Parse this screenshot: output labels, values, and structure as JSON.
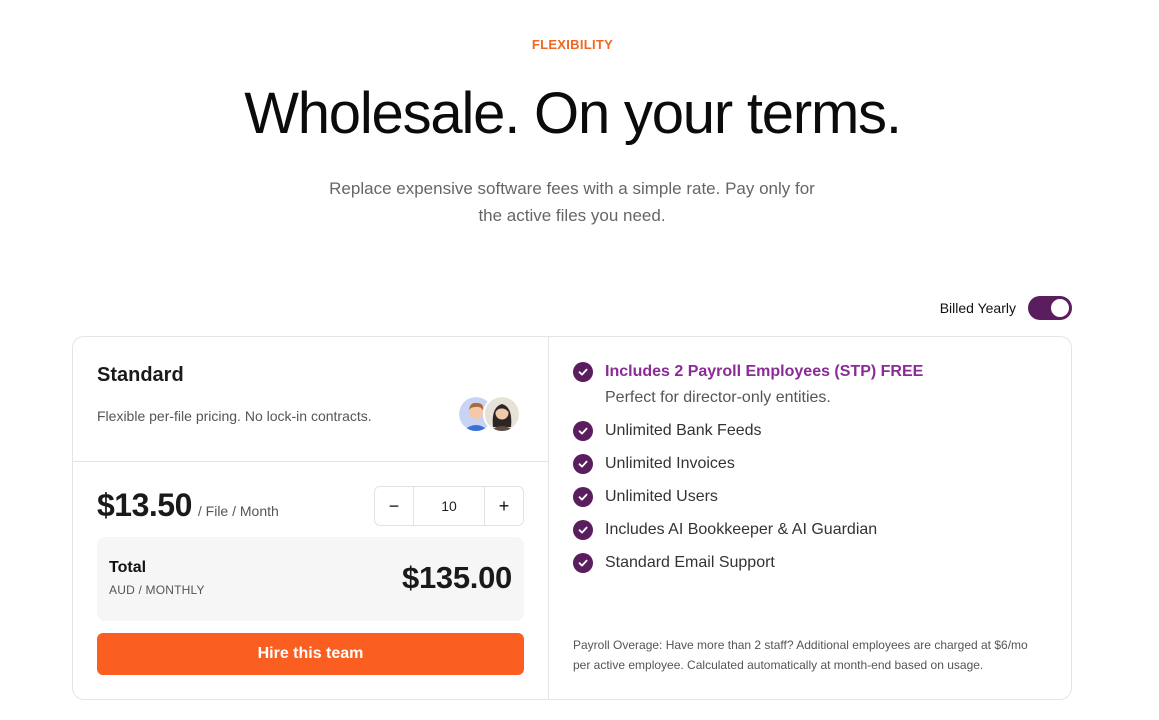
{
  "hero": {
    "eyebrow": "FLEXIBILITY",
    "title": "Wholesale. On your terms.",
    "subtitle": "Replace expensive software fees with a simple rate. Pay only for the active files you need."
  },
  "billing": {
    "label": "Billed Yearly",
    "enabled": true,
    "accent_color": "#5a1d5e"
  },
  "plan": {
    "name": "Standard",
    "description": "Flexible per-file pricing. No lock-in contracts.",
    "price": "$13.50",
    "price_unit": "/ File / Month",
    "quantity": "10",
    "decrement_label": "−",
    "increment_label": "+",
    "total_label": "Total",
    "total_sub": "AUD / MONTHLY",
    "total_amount": "$135.00",
    "cta_label": "Hire this team",
    "cta_color": "#fb5e21",
    "avatars": [
      "avatar-man-icon",
      "avatar-woman-icon"
    ]
  },
  "features": {
    "items": [
      {
        "label": "Includes 2 Payroll Employees (STP) FREE",
        "note": "Perfect for director-only entities.",
        "highlight": true
      },
      {
        "label": "Unlimited Bank Feeds"
      },
      {
        "label": "Unlimited Invoices"
      },
      {
        "label": "Unlimited Users"
      },
      {
        "label": "Includes AI Bookkeeper & AI Guardian"
      },
      {
        "label": "Standard Email Support"
      }
    ],
    "overage_note": "Payroll Overage: Have more than 2 staff? Additional employees are charged at $6/mo per active employee. Calculated automatically at month-end based on usage."
  },
  "colors": {
    "eyebrow": "#f26522",
    "highlight_text": "#8a2b96",
    "check": "#5a1d5e"
  }
}
